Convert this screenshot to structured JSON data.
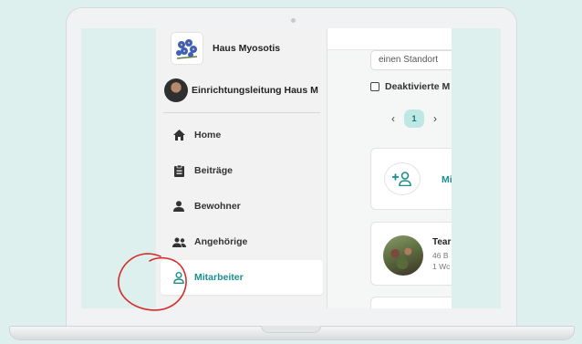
{
  "org": {
    "name": "Haus Myosotis",
    "logo_icon": "forget-me-not-flower-logo"
  },
  "user": {
    "name": "Einrichtungsleitung Haus M"
  },
  "nav": [
    {
      "label": "Home",
      "icon": "home-icon"
    },
    {
      "label": "Beiträge",
      "icon": "posts-icon"
    },
    {
      "label": "Bewohner",
      "icon": "resident-icon"
    },
    {
      "label": "Angehörige",
      "icon": "relatives-icon"
    },
    {
      "label": "Mitarbeiter",
      "icon": "staff-icon",
      "active": true
    }
  ],
  "main": {
    "location_select": "einen Standort",
    "deactivated_label": "Deaktivierte M",
    "pager": {
      "prev": "‹",
      "current": "1",
      "next": "›"
    },
    "add_card_label": "Mi",
    "team_card": {
      "title": "Tear",
      "line1": "46 B",
      "line2": "1 Wc"
    }
  },
  "colors": {
    "accent": "#1a8f8b",
    "marker": "#d62b2b",
    "background": "#ddf0ee"
  }
}
